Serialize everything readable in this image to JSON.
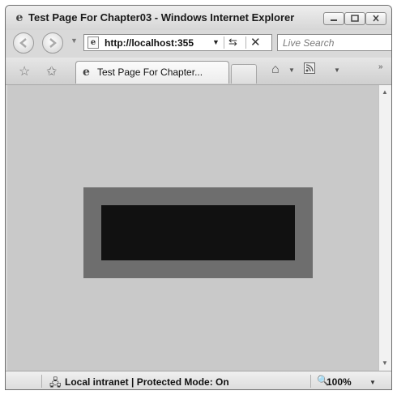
{
  "window": {
    "title": "Test Page For Chapter03 - Windows Internet Explorer",
    "icons": {
      "app": "ie-logo-icon",
      "minimize": "minimize-icon",
      "maximize": "maximize-icon",
      "close": "close-icon"
    }
  },
  "navbar": {
    "back_icon": "back-arrow-icon",
    "forward_icon": "forward-arrow-icon",
    "history_dropdown_icon": "chevron-down-icon",
    "address": {
      "url": "http://localhost:355",
      "page_icon": "page-icon",
      "dropdown_icon": "chevron-down-icon"
    },
    "refresh_icon": "refresh-icon",
    "stop_icon": "stop-icon",
    "search": {
      "placeholder": "Live Search"
    }
  },
  "tabs": {
    "favorites_icon": "favorites-star-icon",
    "add_favorites_icon": "add-favorites-icon",
    "items": [
      {
        "label": "Test Page For Chapter...",
        "icon": "ie-logo-icon",
        "active": true
      }
    ],
    "new_tab_icon": "new-tab-icon",
    "home_icon": "home-icon",
    "feeds_icon": "rss-feed-icon",
    "overflow_icon": "chevron-right-double-icon"
  },
  "content": {
    "colors": {
      "background": "#c9c9c9",
      "outer_box": "#6e6e6e",
      "inner_box": "#111111"
    }
  },
  "statusbar": {
    "zone_icon": "local-intranet-icon",
    "status_text": "Local intranet | Protected Mode: On",
    "zoom_icon": "zoom-magnifier-icon",
    "zoom": "100%"
  }
}
